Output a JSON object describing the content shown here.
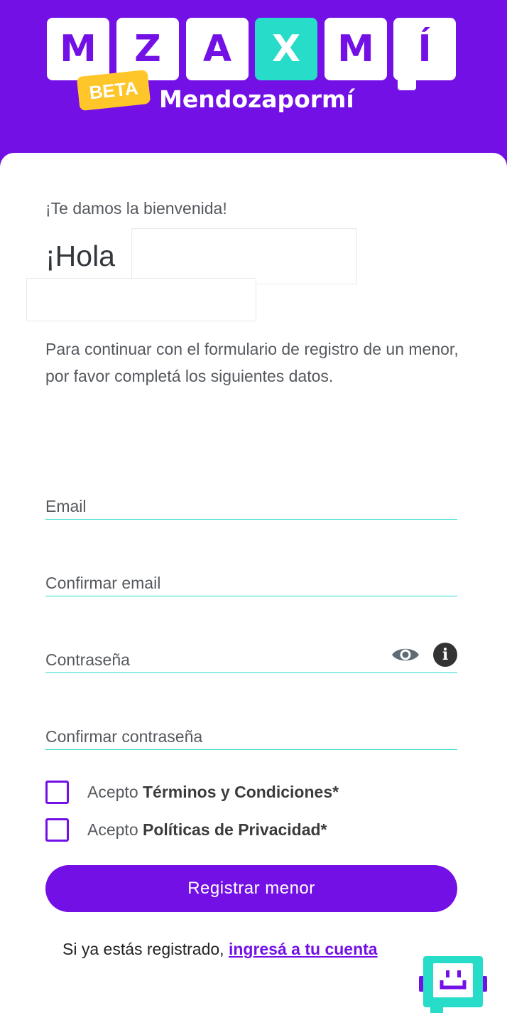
{
  "header": {
    "tiles": [
      "M",
      "Z",
      "A",
      "X",
      "M",
      "Í"
    ],
    "beta_badge": "BETA",
    "brand_name": "Mendozapormí",
    "colors": {
      "primary": "#7310e6",
      "accent": "#27dcc8",
      "badge": "#ffc629"
    }
  },
  "main": {
    "welcome": "¡Te damos la bienvenida!",
    "greeting": "¡Hola",
    "intro": "Para continuar con el formulario de registro de un menor, por favor completá los siguientes datos."
  },
  "form": {
    "email_label": "Email",
    "confirm_email_label": "Confirmar email",
    "password_label": "Contraseña",
    "confirm_password_label": "Confirmar contraseña",
    "terms_prefix": "Acepto",
    "terms_link": "Términos y Condiciones*",
    "privacy_prefix": "Acepto",
    "privacy_link": "Políticas de Privacidad*",
    "submit_label": "Registrar menor"
  },
  "footer": {
    "login_prompt": "Si ya estás registrado,",
    "login_link": "ingresá a tu cuenta"
  },
  "icons": {
    "password_visibility": "eye-icon",
    "password_info": "info-icon",
    "chat": "chat-icon"
  }
}
